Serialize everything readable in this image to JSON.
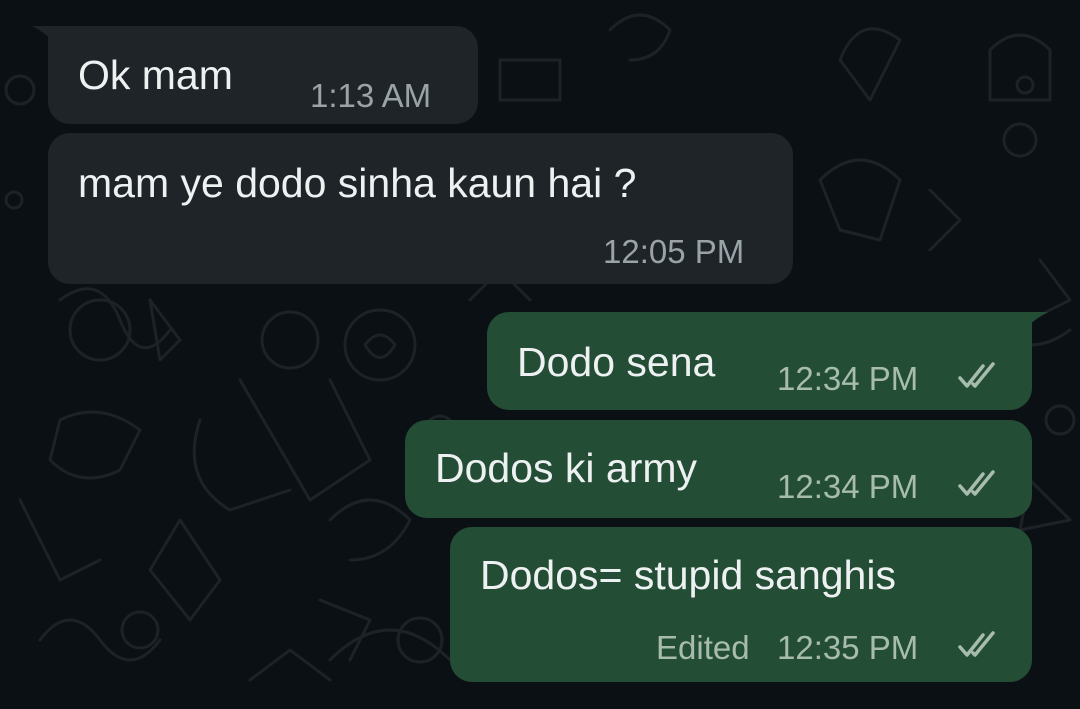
{
  "messages": [
    {
      "direction": "incoming",
      "text": "Ok mam",
      "time": "1:13 AM"
    },
    {
      "direction": "incoming",
      "text": "mam ye dodo sinha kaun hai ?",
      "time": "12:05 PM"
    },
    {
      "direction": "outgoing",
      "text": "Dodo sena",
      "time": "12:34 PM",
      "status_icon": "double-check-icon"
    },
    {
      "direction": "outgoing",
      "text": "Dodos ki army",
      "time": "12:34 PM",
      "status_icon": "double-check-icon"
    },
    {
      "direction": "outgoing",
      "text": "Dodos= stupid sanghis",
      "edited_label": "Edited",
      "time": "12:35 PM",
      "status_icon": "double-check-icon"
    }
  ],
  "colors": {
    "background": "#0b1014",
    "incoming_bubble": "#1f2428",
    "outgoing_bubble": "#234d35",
    "message_text": "#eef1f2",
    "timestamp_text": "#9aa3a8"
  }
}
